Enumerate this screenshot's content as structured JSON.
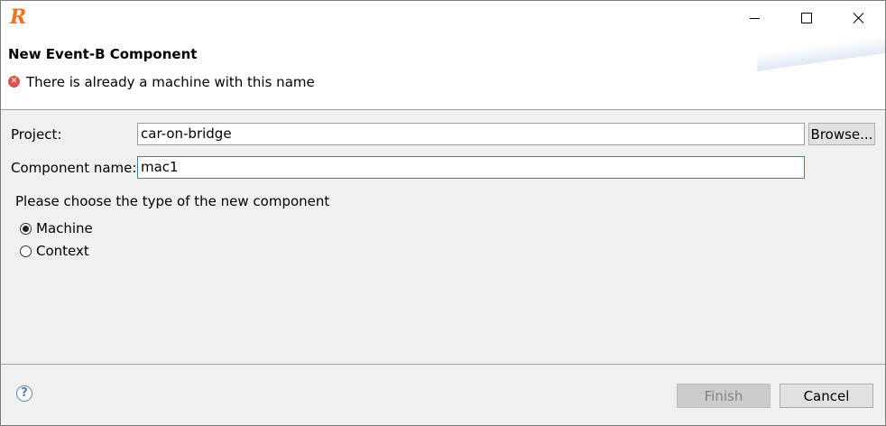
{
  "app_icon": "R",
  "window_controls": {
    "minimize_icon": "minimize-icon",
    "maximize_icon": "maximize-icon",
    "close_icon": "close-icon"
  },
  "header": {
    "title": "New Event-B Component",
    "message": "There is already a machine with this name",
    "message_icon": "error-icon"
  },
  "form": {
    "project_label": "Project:",
    "project_value": "car-on-bridge",
    "browse_label": "Browse...",
    "component_label": "Component name:",
    "component_value": "mac1",
    "type_prompt": "Please choose the type of the new component",
    "options": [
      {
        "label": "Machine",
        "checked": true
      },
      {
        "label": "Context",
        "checked": false
      }
    ]
  },
  "footer": {
    "help_icon": "?",
    "finish_label": "Finish",
    "finish_enabled": false,
    "cancel_label": "Cancel"
  },
  "colors": {
    "error": "#d9544f",
    "focus_border": "#3c7fb1",
    "app_icon": "#e8742a"
  }
}
